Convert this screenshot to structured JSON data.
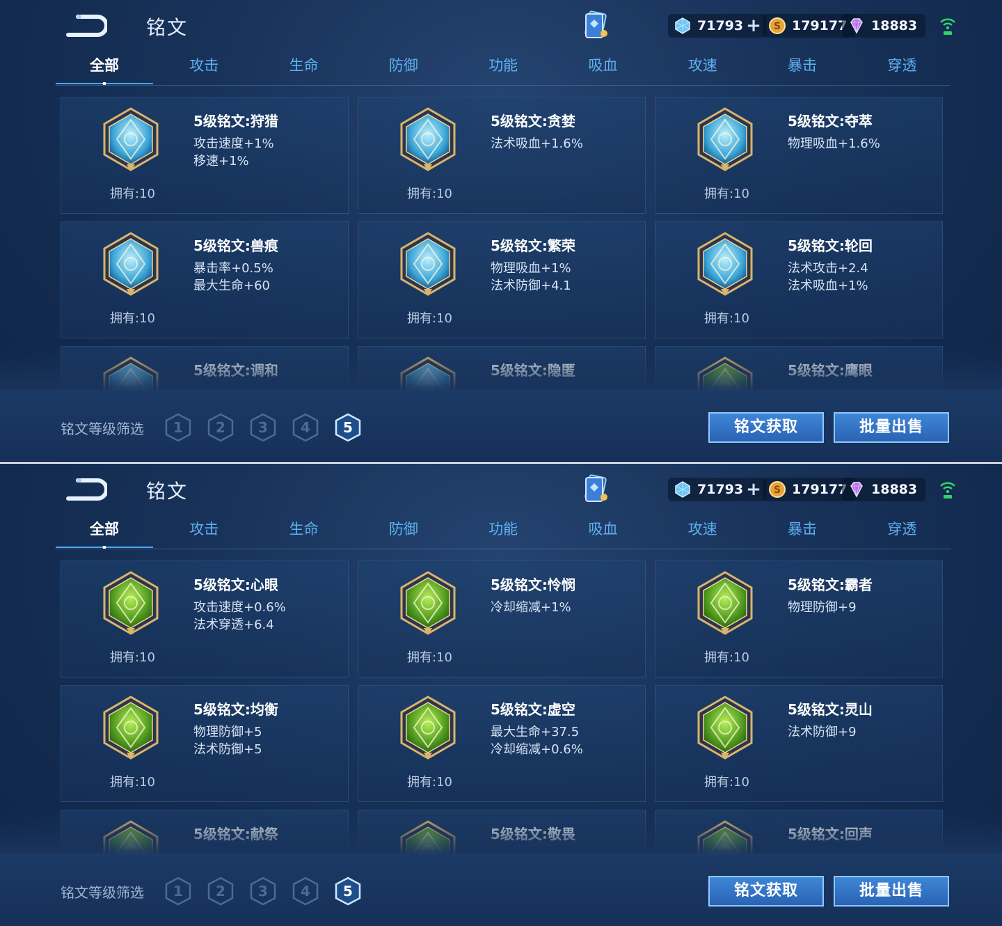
{
  "shots": [
    {
      "header": {
        "title": "铭文"
      },
      "currencies": [
        {
          "name": "crystal-icon",
          "value": "71793",
          "plus": "+",
          "color": "#8fd4ff"
        },
        {
          "name": "gold-coin-icon",
          "value": "179177",
          "plus": "",
          "color": "#e8a23a"
        },
        {
          "name": "diamond-icon",
          "value": "18883",
          "plus": "",
          "color": "#c77dff"
        }
      ],
      "tabs": [
        "全部",
        "攻击",
        "生命",
        "防御",
        "功能",
        "吸血",
        "攻速",
        "暴击",
        "穿透"
      ],
      "active_tab": 0,
      "items": [
        {
          "name": "5级铭文:狩猎",
          "attrs": [
            "攻击速度+1%",
            "移速+1%"
          ],
          "own": "拥有:10",
          "gem": "blue"
        },
        {
          "name": "5级铭文:贪婪",
          "attrs": [
            "法术吸血+1.6%"
          ],
          "own": "拥有:10",
          "gem": "blue"
        },
        {
          "name": "5级铭文:夺萃",
          "attrs": [
            "物理吸血+1.6%"
          ],
          "own": "拥有:10",
          "gem": "blue"
        },
        {
          "name": "5级铭文:兽痕",
          "attrs": [
            "暴击率+0.5%",
            "最大生命+60"
          ],
          "own": "拥有:10",
          "gem": "blue"
        },
        {
          "name": "5级铭文:繁荣",
          "attrs": [
            "物理吸血+1%",
            "法术防御+4.1"
          ],
          "own": "拥有:10",
          "gem": "blue"
        },
        {
          "name": "5级铭文:轮回",
          "attrs": [
            "法术攻击+2.4",
            "法术吸血+1%"
          ],
          "own": "拥有:10",
          "gem": "blue"
        },
        {
          "name": "5级铭文:调和",
          "attrs": [],
          "own": "",
          "gem": "blue"
        },
        {
          "name": "5级铭文:隐匿",
          "attrs": [],
          "own": "",
          "gem": "blue"
        },
        {
          "name": "5级铭文:鹰眼",
          "attrs": [],
          "own": "",
          "gem": "green"
        }
      ],
      "filter_label": "铭文等级筛选",
      "levels": [
        "1",
        "2",
        "3",
        "4",
        "5"
      ],
      "active_level": 4,
      "buttons": {
        "acquire": "铭文获取",
        "bulk_sell": "批量出售"
      }
    },
    {
      "header": {
        "title": "铭文"
      },
      "currencies": [
        {
          "name": "crystal-icon",
          "value": "71793",
          "plus": "+",
          "color": "#8fd4ff"
        },
        {
          "name": "gold-coin-icon",
          "value": "179177",
          "plus": "",
          "color": "#e8a23a"
        },
        {
          "name": "diamond-icon",
          "value": "18883",
          "plus": "",
          "color": "#c77dff"
        }
      ],
      "tabs": [
        "全部",
        "攻击",
        "生命",
        "防御",
        "功能",
        "吸血",
        "攻速",
        "暴击",
        "穿透"
      ],
      "active_tab": 0,
      "items": [
        {
          "name": "5级铭文:心眼",
          "attrs": [
            "攻击速度+0.6%",
            "法术穿透+6.4"
          ],
          "own": "拥有:10",
          "gem": "green"
        },
        {
          "name": "5级铭文:怜悯",
          "attrs": [
            "冷却缩减+1%"
          ],
          "own": "拥有:10",
          "gem": "green"
        },
        {
          "name": "5级铭文:霸者",
          "attrs": [
            "物理防御+9"
          ],
          "own": "拥有:10",
          "gem": "green"
        },
        {
          "name": "5级铭文:均衡",
          "attrs": [
            "物理防御+5",
            "法术防御+5"
          ],
          "own": "拥有:10",
          "gem": "green"
        },
        {
          "name": "5级铭文:虚空",
          "attrs": [
            "最大生命+37.5",
            "冷却缩减+0.6%"
          ],
          "own": "拥有:10",
          "gem": "green"
        },
        {
          "name": "5级铭文:灵山",
          "attrs": [
            "法术防御+9"
          ],
          "own": "拥有:10",
          "gem": "green"
        },
        {
          "name": "5级铭文:献祭",
          "attrs": [],
          "own": "",
          "gem": "green"
        },
        {
          "name": "5级铭文:敬畏",
          "attrs": [],
          "own": "",
          "gem": "green"
        },
        {
          "name": "5级铭文:回声",
          "attrs": [],
          "own": "",
          "gem": "green"
        }
      ],
      "filter_label": "铭文等级筛选",
      "levels": [
        "1",
        "2",
        "3",
        "4",
        "5"
      ],
      "active_level": 4,
      "buttons": {
        "acquire": "铭文获取",
        "bulk_sell": "批量出售"
      }
    }
  ]
}
